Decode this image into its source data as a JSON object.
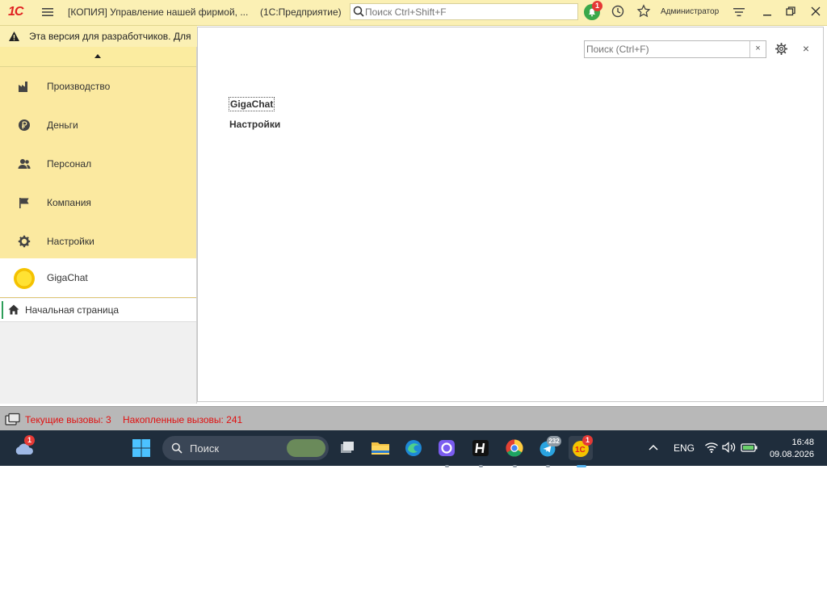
{
  "app": {
    "logo_text": "1С",
    "window_title": "[КОПИЯ] Управление нашей фирмой, ...",
    "platform": "(1С:Предприятие)",
    "global_search_placeholder": "Поиск Ctrl+Shift+F",
    "notifications_count": "1",
    "user_name": "Администратор"
  },
  "warning": {
    "text": "Эта версия для разработчиков. Для"
  },
  "sidebar": {
    "sections": [
      {
        "label": "Производство",
        "icon": "factory-icon"
      },
      {
        "label": "Деньги",
        "icon": "ruble-icon"
      },
      {
        "label": "Персонал",
        "icon": "people-icon"
      },
      {
        "label": "Компания",
        "icon": "flag-icon"
      },
      {
        "label": "Настройки",
        "icon": "gear-icon"
      }
    ],
    "active_section": {
      "label": "GigaChat",
      "icon": "gigachat-icon"
    },
    "home_label": "Начальная страница"
  },
  "main": {
    "search_placeholder": "Поиск (Ctrl+F)",
    "clear_label": "×",
    "close_label": "×",
    "links": [
      "GigaChat",
      "Настройки"
    ]
  },
  "status": {
    "current_calls": "Текущие вызовы: 3",
    "accumulated_calls": "Накопленные вызовы: 241"
  },
  "taskbar": {
    "weather_badge": "1",
    "search_label": "Поиск",
    "telegram_badge": "232",
    "onec_badge": "1",
    "lang": "ENG",
    "time": "16:48",
    "date": "09.08.2026"
  },
  "colors": {
    "accent_yellow": "#fbe9a0",
    "status_red": "#e01010",
    "taskbar_bg": "#1f2d3c"
  }
}
